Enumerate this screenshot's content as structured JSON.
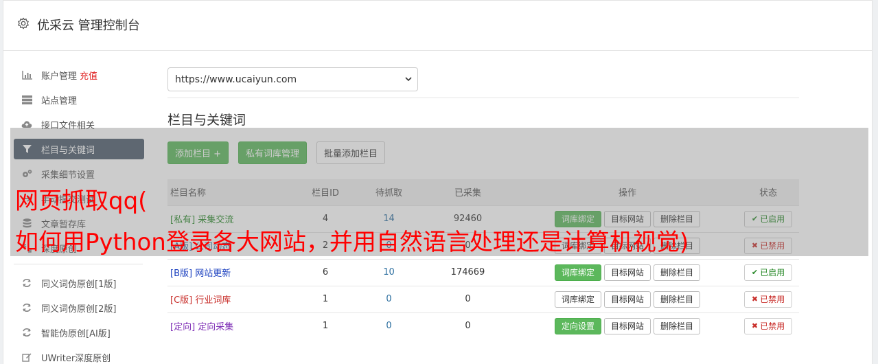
{
  "header": {
    "title": "优采云 管理控制台",
    "icon": "gear-icon"
  },
  "sidebar": {
    "items": [
      {
        "label": "账户管理",
        "extra": "充值",
        "icon": "bar-chart-icon"
      },
      {
        "label": "站点管理",
        "icon": "server-icon"
      },
      {
        "label": "接口文件相关",
        "icon": "cloud-upload-icon"
      },
      {
        "label": "栏目与关键词",
        "icon": "filter-icon",
        "active": true
      },
      {
        "label": "采集细节设置",
        "icon": "gears-icon"
      },
      {
        "label": "手动提交测试",
        "icon": "arrow-icon"
      },
      {
        "label": "文章暂存库",
        "icon": "database-icon"
      },
      {
        "label": "深度原创",
        "icon": "resize-icon"
      }
    ],
    "tools": [
      {
        "label": "同义词伪原创[1版]",
        "icon": "refresh-icon"
      },
      {
        "label": "同义词伪原创[2版]",
        "icon": "refresh-icon"
      },
      {
        "label": "智能伪原创[AI版]",
        "icon": "refresh-icon"
      },
      {
        "label": "UWriter深度原创",
        "icon": "edit-icon"
      }
    ]
  },
  "main": {
    "site_select": "https://www.ucaiyun.com",
    "section_title": "栏目与关键词",
    "buttons": {
      "add": "添加栏目 +",
      "private_lib": "私有词库管理",
      "batch_add": "批量添加栏目"
    },
    "table": {
      "headers": [
        "栏目名称",
        "栏目ID",
        "待抓取",
        "已采集",
        "操作",
        "状态"
      ],
      "rows": [
        {
          "tag": "[私有]",
          "name": "采集交流",
          "id": "4",
          "wait": "14",
          "done": "92460",
          "op1": "词库绑定",
          "op1_active": true,
          "op2": "目标网站",
          "op3": "删除栏目",
          "status": "已启用",
          "on": true,
          "cls": "tag-private"
        },
        {
          "tag": "[A版]",
          "name": "公司动态",
          "id": "2",
          "wait": "0",
          "done": "0",
          "op1": "词库绑定",
          "op1_active": false,
          "op2": "目标网站",
          "op3": "删除栏目",
          "status": "已禁用",
          "on": false,
          "cls": "tag-a"
        },
        {
          "tag": "[B版]",
          "name": "网站更新",
          "id": "6",
          "wait": "10",
          "done": "174669",
          "op1": "词库绑定",
          "op1_active": true,
          "op2": "目标网站",
          "op3": "删除栏目",
          "status": "已启用",
          "on": true,
          "cls": "tag-b"
        },
        {
          "tag": "[C版]",
          "name": "行业词库",
          "id": "1",
          "wait": "0",
          "done": "0",
          "op1": "词库绑定",
          "op1_active": false,
          "op2": "目标网站",
          "op3": "删除栏目",
          "status": "已禁用",
          "on": false,
          "cls": "tag-c"
        },
        {
          "tag": "[定向]",
          "name": "定向采集",
          "id": "1",
          "wait": "0",
          "done": "0",
          "op1": "定向设置",
          "op1_active": true,
          "op2": "目标网站",
          "op3": "删除栏目",
          "status": "已禁用",
          "on": false,
          "cls": "tag-d"
        }
      ]
    }
  },
  "watermark": {
    "line1": "网页抓取qq(",
    "line2": "如何用Python登录各大网站，并用自然语言处理还是计算机视觉)"
  }
}
